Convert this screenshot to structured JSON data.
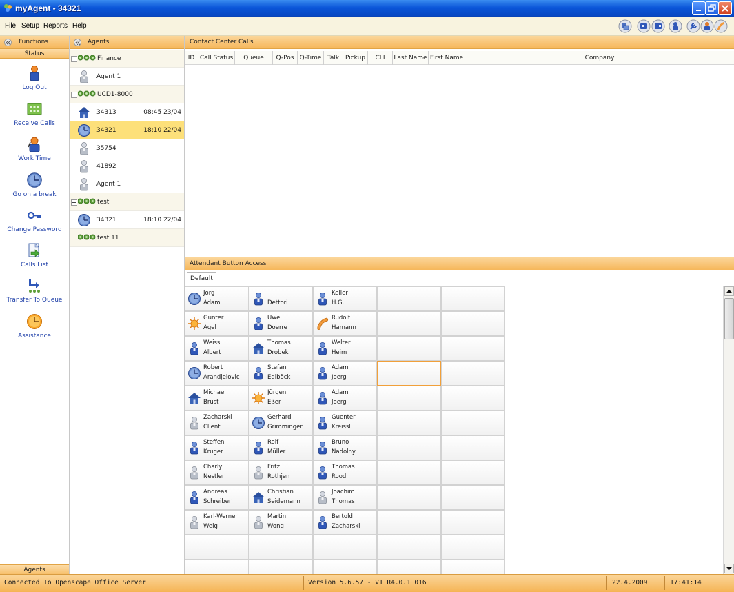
{
  "window": {
    "title": "myAgent - 34321"
  },
  "menu": {
    "items": [
      "File",
      "Setup",
      "Reports",
      "Help"
    ]
  },
  "functions": {
    "header": "Functions",
    "status_band": "Status",
    "items": [
      {
        "label": "Log Out",
        "icon": "agent-person-icon"
      },
      {
        "label": "Receive Calls",
        "icon": "keypad-icon"
      },
      {
        "label": "Work Time",
        "icon": "agent-headset-icon"
      },
      {
        "label": "Go on a break",
        "icon": "clock-icon"
      },
      {
        "label": "Change Password",
        "icon": "key-icon"
      },
      {
        "label": "Calls List",
        "icon": "calls-list-icon"
      },
      {
        "label": "Transfer To Queue",
        "icon": "transfer-queue-icon"
      },
      {
        "label": "Assistance",
        "icon": "assistance-clock-icon"
      }
    ],
    "bottom_band": "Agents"
  },
  "agents": {
    "header": "Agents",
    "rows": [
      {
        "kind": "group",
        "label": "Finance"
      },
      {
        "kind": "agent",
        "label": "Agent 1",
        "icon": "person-gray-icon",
        "time": ""
      },
      {
        "kind": "group",
        "label": "UCD1-8000"
      },
      {
        "kind": "agent",
        "label": "34313",
        "icon": "home-icon",
        "time": "08:45 23/04"
      },
      {
        "kind": "agent",
        "label": "34321",
        "icon": "clock-icon",
        "time": "18:10 22/04",
        "selected": true
      },
      {
        "kind": "agent",
        "label": "35754",
        "icon": "person-gray-icon",
        "time": ""
      },
      {
        "kind": "agent",
        "label": "41892",
        "icon": "person-gray-icon",
        "time": ""
      },
      {
        "kind": "agent",
        "label": "Agent 1",
        "icon": "person-gray-icon",
        "time": ""
      },
      {
        "kind": "group",
        "label": "test"
      },
      {
        "kind": "agent",
        "label": "34321",
        "icon": "clock-icon",
        "time": "18:10 22/04"
      },
      {
        "kind": "group-nominus",
        "label": "test 11"
      }
    ]
  },
  "calls": {
    "header": "Contact Center Calls",
    "columns": [
      "ID",
      "Call Status",
      "Queue",
      "Q-Pos",
      "Q-Time",
      "Talk",
      "Pickup",
      "CLI",
      "Last Name",
      "First Name",
      "Company"
    ]
  },
  "attendant": {
    "header": "Attendant Button Access",
    "tab": "Default",
    "buttons": [
      [
        {
          "l1": "Jörg",
          "l2": "Adam",
          "icon": "clock-icon"
        },
        {
          "l1": "",
          "l2": "Dettori",
          "icon": "person-blue-icon"
        },
        {
          "l1": "Keller",
          "l2": "H.G.",
          "icon": "person-blue-icon"
        },
        null,
        null
      ],
      [
        {
          "l1": "Günter",
          "l2": "Agel",
          "icon": "sun-icon"
        },
        {
          "l1": "Uwe",
          "l2": "Doerre",
          "icon": "person-blue-icon"
        },
        {
          "l1": "Rudolf",
          "l2": "Hamann",
          "icon": "phone-handset-icon"
        },
        null,
        null
      ],
      [
        {
          "l1": "Weiss",
          "l2": "Albert",
          "icon": "person-blue-icon"
        },
        {
          "l1": "Thomas",
          "l2": "Drobek",
          "icon": "home-icon"
        },
        {
          "l1": "Welter",
          "l2": "Heim",
          "icon": "person-blue-icon"
        },
        null,
        null
      ],
      [
        {
          "l1": "Robert",
          "l2": "Arandjelovic",
          "icon": "clock-icon"
        },
        {
          "l1": "Stefan",
          "l2": "Edlböck",
          "icon": "person-blue-icon"
        },
        {
          "l1": "Adam",
          "l2": "Joerg",
          "icon": "person-blue-icon"
        },
        "focused",
        null
      ],
      [
        {
          "l1": "Michael",
          "l2": "Brust",
          "icon": "home-icon"
        },
        {
          "l1": "Jürgen",
          "l2": "Eßer",
          "icon": "sun-icon"
        },
        {
          "l1": "Adam",
          "l2": "Joerg",
          "icon": "person-blue-icon"
        },
        null,
        null
      ],
      [
        {
          "l1": "Zacharski",
          "l2": "Client",
          "icon": "person-gray-icon"
        },
        {
          "l1": "Gerhard",
          "l2": "Grimminger",
          "icon": "clock-icon"
        },
        {
          "l1": "Guenter",
          "l2": "Kreissl",
          "icon": "person-blue-icon"
        },
        null,
        null
      ],
      [
        {
          "l1": "Steffen",
          "l2": "Kruger",
          "icon": "person-blue-icon"
        },
        {
          "l1": "Rolf",
          "l2": "Müller",
          "icon": "person-blue-icon"
        },
        {
          "l1": "Bruno",
          "l2": "Nadolny",
          "icon": "person-blue-icon"
        },
        null,
        null
      ],
      [
        {
          "l1": "Charly",
          "l2": "Nestler",
          "icon": "person-gray-icon"
        },
        {
          "l1": "Fritz",
          "l2": "Rothjen",
          "icon": "person-gray-icon"
        },
        {
          "l1": "Thomas",
          "l2": "Roodl",
          "icon": "person-blue-icon"
        },
        null,
        null
      ],
      [
        {
          "l1": "Andreas",
          "l2": "Schreiber",
          "icon": "person-blue-icon"
        },
        {
          "l1": "Christian",
          "l2": "Seidemann",
          "icon": "home-icon"
        },
        {
          "l1": "Joachim",
          "l2": "Thomas",
          "icon": "person-gray-icon"
        },
        null,
        null
      ],
      [
        {
          "l1": "Karl-Werner",
          "l2": "Weig",
          "icon": "person-gray-icon"
        },
        {
          "l1": "Martin",
          "l2": "Wong",
          "icon": "person-gray-icon"
        },
        {
          "l1": "Bertold",
          "l2": "Zacharski",
          "icon": "person-blue-icon"
        },
        null,
        null
      ],
      [
        null,
        null,
        null,
        null,
        null
      ],
      [
        null,
        null,
        null,
        null,
        null
      ]
    ]
  },
  "statusbar": {
    "connection": "Connected To Openscape Office Server",
    "version": "Version 5.6.57 - V1_R4.0.1_016",
    "date": "22.4.2009",
    "time": "17:41:14"
  },
  "colors": {
    "accent_orange": "#f6b75b",
    "selection_yellow": "#fde07a",
    "link_blue": "#1e3fa8",
    "title_blue": "#0a55d8"
  }
}
